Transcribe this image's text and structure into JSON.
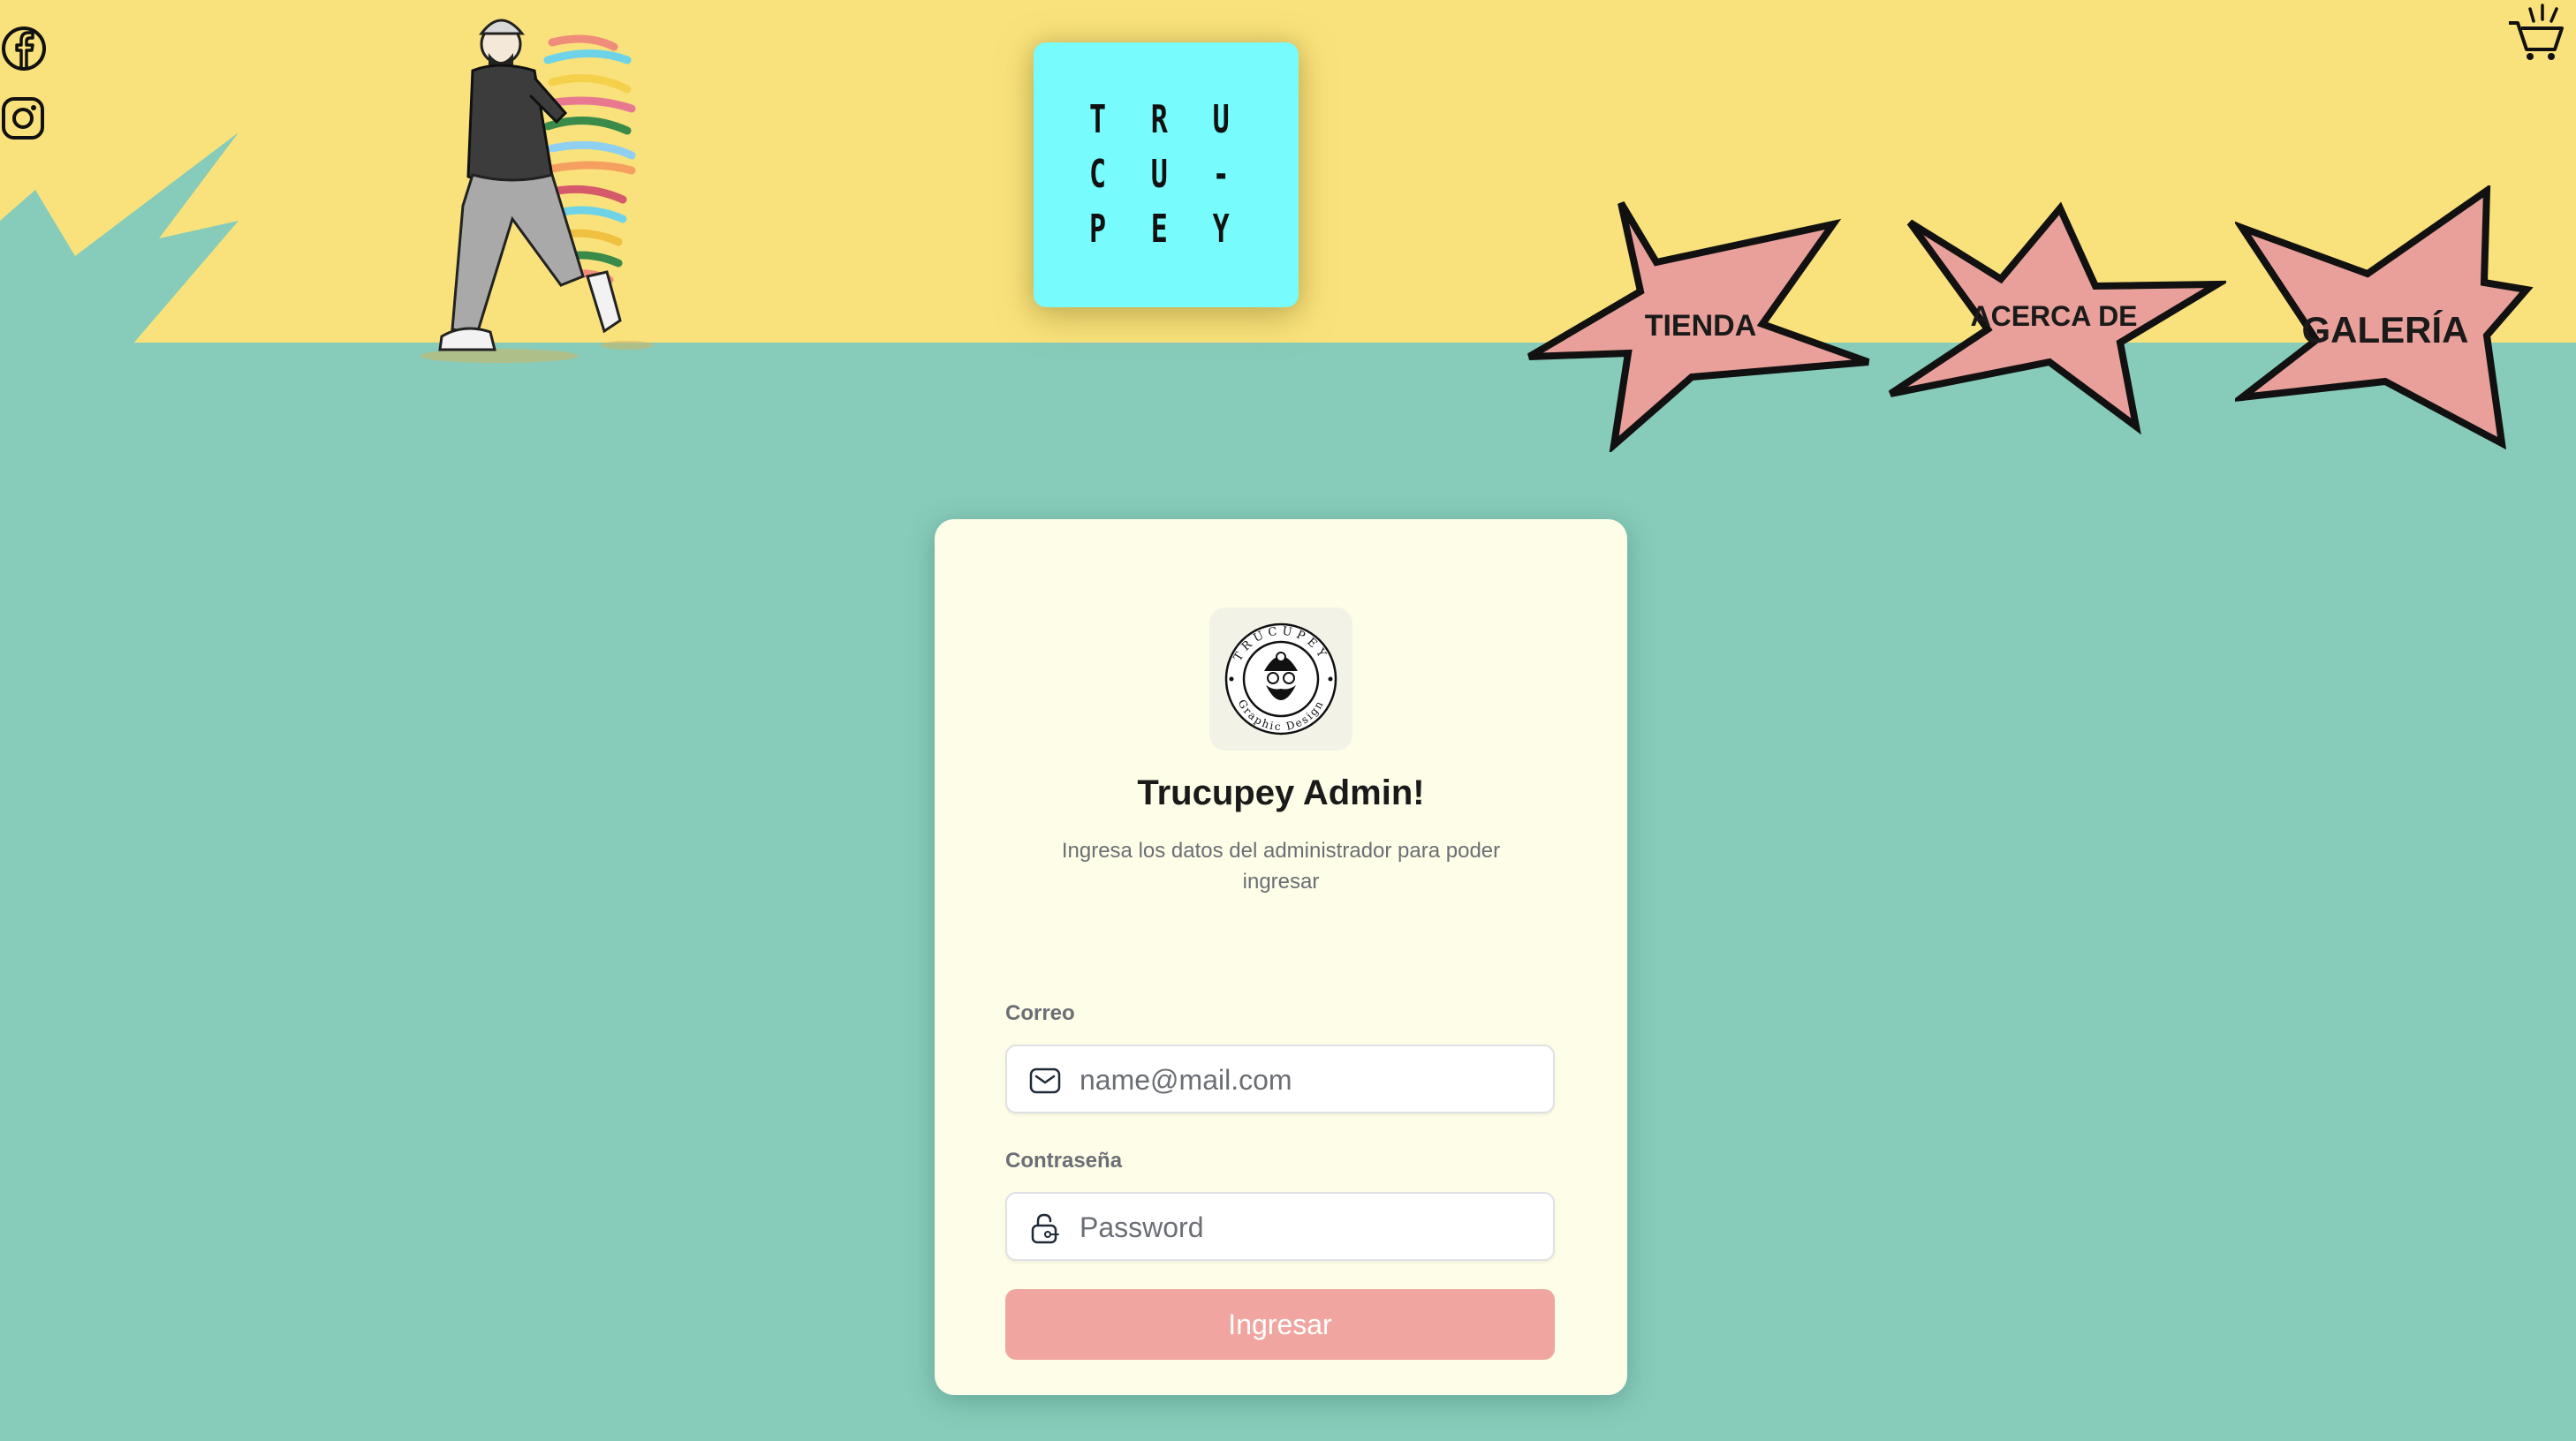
{
  "logo": {
    "lines": [
      "T R U",
      "C U -",
      "P E Y"
    ]
  },
  "nav": {
    "items": [
      {
        "label": "TIENDA"
      },
      {
        "label": "ACERCA DE"
      },
      {
        "label": "GALERÍA"
      }
    ]
  },
  "icons": {
    "social": [
      "facebook-icon",
      "instagram-icon"
    ],
    "cart": "shopping-cart-icon",
    "email": "mail-icon",
    "password": "lock-icon"
  },
  "login": {
    "title": "Trucupey Admin!",
    "subtitle": "Ingresa los datos del administrador para poder ingresar",
    "email_label": "Correo",
    "email_placeholder": "name@mail.com",
    "password_label": "Contraseña",
    "password_placeholder": "Password",
    "submit_label": "Ingresar",
    "badge_text_top": "TRUCUPEY",
    "badge_text_bottom": "Graphic Design"
  },
  "colors": {
    "header_yellow": "#f9e27b",
    "background_teal": "#87cbba",
    "logo_cyan": "#77fbfc",
    "star_pink": "#e9a09a",
    "card_cream": "#fefde7",
    "button_pink": "#f1a5a0"
  }
}
